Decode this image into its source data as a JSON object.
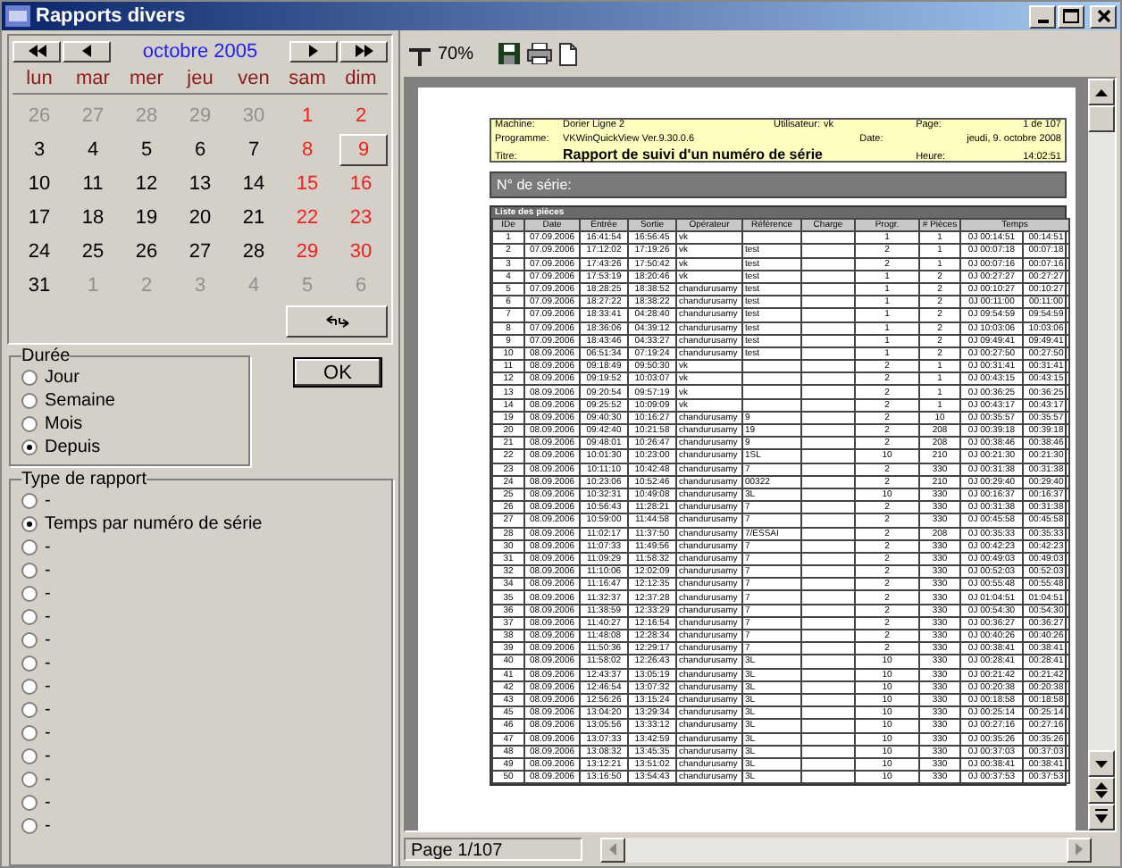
{
  "window": {
    "title": "Rapports divers"
  },
  "calendar": {
    "month": "octobre 2005",
    "weekdays": [
      "lun",
      "mar",
      "mer",
      "jeu",
      "ven",
      "sam",
      "dim"
    ],
    "weeks": [
      [
        {
          "day": "26",
          "other_month": true,
          "selected": false
        },
        {
          "day": "27",
          "other_month": true,
          "selected": false
        },
        {
          "day": "28",
          "other_month": true,
          "selected": false
        },
        {
          "day": "29",
          "other_month": true,
          "selected": false
        },
        {
          "day": "30",
          "other_month": true,
          "selected": false
        },
        {
          "day": "1",
          "other_month": false,
          "selected": false
        },
        {
          "day": "2",
          "other_month": false,
          "selected": false
        }
      ],
      [
        {
          "day": "3",
          "other_month": false,
          "selected": false
        },
        {
          "day": "4",
          "other_month": false,
          "selected": false
        },
        {
          "day": "5",
          "other_month": false,
          "selected": false
        },
        {
          "day": "6",
          "other_month": false,
          "selected": false
        },
        {
          "day": "7",
          "other_month": false,
          "selected": false
        },
        {
          "day": "8",
          "other_month": false,
          "selected": false
        },
        {
          "day": "9",
          "other_month": false,
          "selected": true
        }
      ],
      [
        {
          "day": "10",
          "other_month": false,
          "selected": false
        },
        {
          "day": "11",
          "other_month": false,
          "selected": false
        },
        {
          "day": "12",
          "other_month": false,
          "selected": false
        },
        {
          "day": "13",
          "other_month": false,
          "selected": false
        },
        {
          "day": "14",
          "other_month": false,
          "selected": false
        },
        {
          "day": "15",
          "other_month": false,
          "selected": false
        },
        {
          "day": "16",
          "other_month": false,
          "selected": false
        }
      ],
      [
        {
          "day": "17",
          "other_month": false,
          "selected": false
        },
        {
          "day": "18",
          "other_month": false,
          "selected": false
        },
        {
          "day": "19",
          "other_month": false,
          "selected": false
        },
        {
          "day": "20",
          "other_month": false,
          "selected": false
        },
        {
          "day": "21",
          "other_month": false,
          "selected": false
        },
        {
          "day": "22",
          "other_month": false,
          "selected": false
        },
        {
          "day": "23",
          "other_month": false,
          "selected": false
        }
      ],
      [
        {
          "day": "24",
          "other_month": false,
          "selected": false
        },
        {
          "day": "25",
          "other_month": false,
          "selected": false
        },
        {
          "day": "26",
          "other_month": false,
          "selected": false
        },
        {
          "day": "27",
          "other_month": false,
          "selected": false
        },
        {
          "day": "28",
          "other_month": false,
          "selected": false
        },
        {
          "day": "29",
          "other_month": false,
          "selected": false
        },
        {
          "day": "30",
          "other_month": false,
          "selected": false
        }
      ],
      [
        {
          "day": "31",
          "other_month": false,
          "selected": false
        },
        {
          "day": "1",
          "other_month": true,
          "selected": false
        },
        {
          "day": "2",
          "other_month": true,
          "selected": false
        },
        {
          "day": "3",
          "other_month": true,
          "selected": false
        },
        {
          "day": "4",
          "other_month": true,
          "selected": false
        },
        {
          "day": "5",
          "other_month": true,
          "selected": false
        },
        {
          "day": "6",
          "other_month": true,
          "selected": false
        }
      ]
    ]
  },
  "duree": {
    "title": "Durée",
    "options": [
      {
        "label": "Jour",
        "selected": false
      },
      {
        "label": "Semaine",
        "selected": false
      },
      {
        "label": "Mois",
        "selected": false
      },
      {
        "label": "Depuis",
        "selected": true
      }
    ]
  },
  "ok_button": "OK",
  "type_rapport": {
    "title": "Type de rapport",
    "options": [
      {
        "label": "-",
        "selected": false
      },
      {
        "label": "Temps par numéro de série",
        "selected": true
      },
      {
        "label": "-",
        "selected": false
      },
      {
        "label": "-",
        "selected": false
      },
      {
        "label": "-",
        "selected": false
      },
      {
        "label": "-",
        "selected": false
      },
      {
        "label": "-",
        "selected": false
      },
      {
        "label": "-",
        "selected": false
      },
      {
        "label": "-",
        "selected": false
      },
      {
        "label": "-",
        "selected": false
      },
      {
        "label": "-",
        "selected": false
      },
      {
        "label": "-",
        "selected": false
      },
      {
        "label": "-",
        "selected": false
      },
      {
        "label": "-",
        "selected": false
      },
      {
        "label": "-",
        "selected": false
      }
    ]
  },
  "toolbar": {
    "zoom": "70%"
  },
  "report": {
    "header": [
      {
        "label": "Machine:",
        "value": "Dorier Ligne 2",
        "label2": "Utilisateur:",
        "value2": "vk",
        "label3": "Page:",
        "value3": "1 de 107"
      },
      {
        "label": "Programme:",
        "value": "VKWinQuickView Ver.9.30.0.6",
        "label3": "Date:",
        "value3": "jeudi, 9. octobre 2008"
      },
      {
        "label": "Titre:",
        "value": "Rapport de suivi d'un numéro de série",
        "label3": "Heure:",
        "value3": "14:02:51"
      }
    ],
    "serial_label": "N° de série:",
    "table_title": "Liste des pièces",
    "columns": [
      "IDe",
      "Date",
      "Entrée",
      "Sortie",
      "Opérateur",
      "Référence",
      "Charge",
      "Progr.",
      "# Pièces",
      "Temps"
    ],
    "rows": [
      {
        "ide": "1",
        "date": "07.09.2006",
        "entree": "16:41:54",
        "sortie": "16:56:45",
        "operateur": "vk",
        "progr": "1",
        "pieces": "1",
        "temps": "0J 00:14:51",
        "temps_2": "00:14:51"
      },
      {
        "ide": "2",
        "date": "07.09.2006",
        "entree": "17:12:02",
        "sortie": "17:19:26",
        "operateur": "vk",
        "reference": "test",
        "progr": "2",
        "pieces": "1",
        "temps": "0J 00:07:18",
        "temps_2": "00:07:18"
      },
      {
        "ide": "3",
        "date": "07.09.2006",
        "entree": "17:43:26",
        "sortie": "17:50:42",
        "operateur": "vk",
        "reference": "test",
        "progr": "2",
        "pieces": "1",
        "temps": "0J 00:07:16",
        "temps_2": "00:07:16"
      },
      {
        "ide": "4",
        "date": "07.09.2006",
        "entree": "17:53:19",
        "sortie": "18:20:46",
        "operateur": "vk",
        "reference": "test",
        "progr": "1",
        "pieces": "2",
        "temps": "0J 00:27:27",
        "temps_2": "00:27:27"
      },
      {
        "ide": "5",
        "date": "07.09.2006",
        "entree": "18:28:25",
        "sortie": "18:38:52",
        "operateur": "chandurusamy",
        "reference": "test",
        "progr": "1",
        "pieces": "2",
        "temps": "0J 00:10:27",
        "temps_2": "00:10:27"
      },
      {
        "ide": "6",
        "date": "07.09.2006",
        "entree": "18:27:22",
        "sortie": "18:38:22",
        "operateur": "chandurusamy",
        "reference": "test",
        "progr": "1",
        "pieces": "2",
        "temps": "0J 00:11:00",
        "temps_2": "00:11:00"
      },
      {
        "ide": "7",
        "date": "07.09.2006",
        "entree": "18:33:41",
        "sortie": "04:28:40",
        "operateur": "chandurusamy",
        "reference": "test",
        "progr": "1",
        "pieces": "2",
        "temps": "0J 09:54:59",
        "temps_2": "09:54:59"
      },
      {
        "ide": "8",
        "date": "07.09.2006",
        "entree": "18:36:06",
        "sortie": "04:39:12",
        "operateur": "chandurusamy",
        "reference": "test",
        "progr": "1",
        "pieces": "2",
        "temps": "0J 10:03:06",
        "temps_2": "10:03:06"
      },
      {
        "ide": "9",
        "date": "07.09.2006",
        "entree": "18:43:46",
        "sortie": "04:33:27",
        "operateur": "chandurusamy",
        "reference": "test",
        "progr": "1",
        "pieces": "2",
        "temps": "0J 09:49:41",
        "temps_2": "09:49:41"
      },
      {
        "ide": "10",
        "date": "08.09.2006",
        "entree": "06:51:34",
        "sortie": "07:19:24",
        "operateur": "chandurusamy",
        "reference": "test",
        "progr": "1",
        "pieces": "2",
        "temps": "0J 00:27:50",
        "temps_2": "00:27:50"
      },
      {
        "ide": "11",
        "date": "08.09.2006",
        "entree": "09:18:49",
        "sortie": "09:50:30",
        "operateur": "vk",
        "progr": "2",
        "pieces": "1",
        "temps": "0J 00:31:41",
        "temps_2": "00:31:41"
      },
      {
        "ide": "12",
        "date": "08.09.2006",
        "entree": "09:19:52",
        "sortie": "10:03:07",
        "operateur": "vk",
        "progr": "2",
        "pieces": "1",
        "temps": "0J 00:43:15",
        "temps_2": "00:43:15"
      },
      {
        "ide": "13",
        "date": "08.09.2006",
        "entree": "09:20:54",
        "sortie": "09:57:19",
        "operateur": "vk",
        "progr": "2",
        "pieces": "1",
        "temps": "0J 00:36:25",
        "temps_2": "00:36:25"
      },
      {
        "ide": "14",
        "date": "08.09.2006",
        "entree": "09:25:52",
        "sortie": "10:09:09",
        "operateur": "vk",
        "progr": "2",
        "pieces": "1",
        "temps": "0J 00:43:17",
        "temps_2": "00:43:17"
      },
      {
        "ide": "19",
        "date": "08.09.2006",
        "entree": "09:40:30",
        "sortie": "10:16:27",
        "operateur": "chandurusamy",
        "reference": "9",
        "progr": "2",
        "pieces": "10",
        "temps": "0J 00:35:57",
        "temps_2": "00:35:57"
      },
      {
        "ide": "20",
        "date": "08.09.2006",
        "entree": "09:42:40",
        "sortie": "10:21:58",
        "operateur": "chandurusamy",
        "reference": "19",
        "progr": "2",
        "pieces": "208",
        "temps": "0J 00:39:18",
        "temps_2": "00:39:18"
      },
      {
        "ide": "21",
        "date": "08.09.2006",
        "entree": "09:48:01",
        "sortie": "10:26:47",
        "operateur": "chandurusamy",
        "reference": "9",
        "progr": "2",
        "pieces": "208",
        "temps": "0J 00:38:46",
        "temps_2": "00:38:46"
      },
      {
        "ide": "22",
        "date": "08.09.2006",
        "entree": "10:01:30",
        "sortie": "10:23:00",
        "operateur": "chandurusamy",
        "reference": "1SL",
        "progr": "10",
        "pieces": "210",
        "temps": "0J 00:21:30",
        "temps_2": "00:21:30"
      },
      {
        "ide": "23",
        "date": "08.09.2006",
        "entree": "10:11:10",
        "sortie": "10:42:48",
        "operateur": "chandurusamy",
        "reference": "7",
        "progr": "2",
        "pieces": "330",
        "temps": "0J 00:31:38",
        "temps_2": "00:31:38"
      },
      {
        "ide": "24",
        "date": "08.09.2006",
        "entree": "10:23:06",
        "sortie": "10:52:46",
        "operateur": "chandurusamy",
        "reference": "00322",
        "progr": "2",
        "pieces": "210",
        "temps": "0J 00:29:40",
        "temps_2": "00:29:40"
      },
      {
        "ide": "25",
        "date": "08.09.2006",
        "entree": "10:32:31",
        "sortie": "10:49:08",
        "operateur": "chandurusamy",
        "reference": "3L",
        "progr": "10",
        "pieces": "330",
        "temps": "0J 00:16:37",
        "temps_2": "00:16:37"
      },
      {
        "ide": "26",
        "date": "08.09.2006",
        "entree": "10:56:43",
        "sortie": "11:28:21",
        "operateur": "chandurusamy",
        "reference": "7",
        "progr": "2",
        "pieces": "330",
        "temps": "0J 00:31:38",
        "temps_2": "00:31:38"
      },
      {
        "ide": "27",
        "date": "08.09.2006",
        "entree": "10:59:00",
        "sortie": "11:44:58",
        "operateur": "chandurusamy",
        "reference": "7",
        "progr": "2",
        "pieces": "330",
        "temps": "0J 00:45:58",
        "temps_2": "00:45:58"
      },
      {
        "ide": "28",
        "date": "08.09.2006",
        "entree": "11:02:17",
        "sortie": "11:37:50",
        "operateur": "chandurusamy",
        "reference": "7/ESSAI",
        "progr": "2",
        "pieces": "208",
        "temps": "0J 00:35:33",
        "temps_2": "00:35:33"
      },
      {
        "ide": "30",
        "date": "08.09.2006",
        "entree": "11:07:33",
        "sortie": "11:49:56",
        "operateur": "chandurusamy",
        "reference": "7",
        "progr": "2",
        "pieces": "330",
        "temps": "0J 00:42:23",
        "temps_2": "00:42:23"
      },
      {
        "ide": "31",
        "date": "08.09.2006",
        "entree": "11:09:29",
        "sortie": "11:58:32",
        "operateur": "chandurusamy",
        "reference": "7",
        "progr": "2",
        "pieces": "330",
        "temps": "0J 00:49:03",
        "temps_2": "00:49:03"
      },
      {
        "ide": "32",
        "date": "08.09.2006",
        "entree": "11:10:06",
        "sortie": "12:02:09",
        "operateur": "chandurusamy",
        "reference": "7",
        "progr": "2",
        "pieces": "330",
        "temps": "0J 00:52:03",
        "temps_2": "00:52:03"
      },
      {
        "ide": "34",
        "date": "08.09.2006",
        "entree": "11:16:47",
        "sortie": "12:12:35",
        "operateur": "chandurusamy",
        "reference": "7",
        "progr": "2",
        "pieces": "330",
        "temps": "0J 00:55:48",
        "temps_2": "00:55:48"
      },
      {
        "ide": "35",
        "date": "08.09.2006",
        "entree": "11:32:37",
        "sortie": "12:37:28",
        "operateur": "chandurusamy",
        "reference": "7",
        "progr": "2",
        "pieces": "330",
        "temps": "0J 01:04:51",
        "temps_2": "01:04:51"
      },
      {
        "ide": "36",
        "date": "08.09.2006",
        "entree": "11:38:59",
        "sortie": "12:33:29",
        "operateur": "chandurusamy",
        "reference": "7",
        "progr": "2",
        "pieces": "330",
        "temps": "0J 00:54:30",
        "temps_2": "00:54:30"
      },
      {
        "ide": "37",
        "date": "08.09.2006",
        "entree": "11:40:27",
        "sortie": "12:16:54",
        "operateur": "chandurusamy",
        "reference": "7",
        "progr": "2",
        "pieces": "330",
        "temps": "0J 00:36:27",
        "temps_2": "00:36:27"
      },
      {
        "ide": "38",
        "date": "08.09.2006",
        "entree": "11:48:08",
        "sortie": "12:28:34",
        "operateur": "chandurusamy",
        "reference": "7",
        "progr": "2",
        "pieces": "330",
        "temps": "0J 00:40:26",
        "temps_2": "00:40:26"
      },
      {
        "ide": "39",
        "date": "08.09.2006",
        "entree": "11:50:36",
        "sortie": "12:29:17",
        "operateur": "chandurusamy",
        "reference": "7",
        "progr": "2",
        "pieces": "330",
        "temps": "0J 00:38:41",
        "temps_2": "00:38:41"
      },
      {
        "ide": "40",
        "date": "08.09.2006",
        "entree": "11:58:02",
        "sortie": "12:26:43",
        "operateur": "chandurusamy",
        "reference": "3L",
        "progr": "10",
        "pieces": "330",
        "temps": "0J 00:28:41",
        "temps_2": "00:28:41"
      },
      {
        "ide": "41",
        "date": "08.09.2006",
        "entree": "12:43:37",
        "sortie": "13:05:19",
        "operateur": "chandurusamy",
        "reference": "3L",
        "progr": "10",
        "pieces": "330",
        "temps": "0J 00:21:42",
        "temps_2": "00:21:42"
      },
      {
        "ide": "42",
        "date": "08.09.2006",
        "entree": "12:46:54",
        "sortie": "13:07:32",
        "operateur": "chandurusamy",
        "reference": "3L",
        "progr": "10",
        "pieces": "330",
        "temps": "0J 00:20:38",
        "temps_2": "00:20:38"
      },
      {
        "ide": "43",
        "date": "08.09.2006",
        "entree": "12:56:26",
        "sortie": "13:15:24",
        "operateur": "chandurusamy",
        "reference": "3L",
        "progr": "10",
        "pieces": "330",
        "temps": "0J 00:18:58",
        "temps_2": "00:18:58"
      },
      {
        "ide": "45",
        "date": "08.09.2006",
        "entree": "13:04:20",
        "sortie": "13:29:34",
        "operateur": "chandurusamy",
        "reference": "3L",
        "progr": "10",
        "pieces": "330",
        "temps": "0J 00:25:14",
        "temps_2": "00:25:14"
      },
      {
        "ide": "46",
        "date": "08.09.2006",
        "entree": "13:05:56",
        "sortie": "13:33:12",
        "operateur": "chandurusamy",
        "reference": "3L",
        "progr": "10",
        "pieces": "330",
        "temps": "0J 00:27:16",
        "temps_2": "00:27:16"
      },
      {
        "ide": "47",
        "date": "08.09.2006",
        "entree": "13:07:33",
        "sortie": "13:42:59",
        "operateur": "chandurusamy",
        "reference": "3L",
        "progr": "10",
        "pieces": "330",
        "temps": "0J 00:35:26",
        "temps_2": "00:35:26"
      },
      {
        "ide": "48",
        "date": "08.09.2006",
        "entree": "13:08:32",
        "sortie": "13:45:35",
        "operateur": "chandurusamy",
        "reference": "3L",
        "progr": "10",
        "pieces": "330",
        "temps": "0J 00:37:03",
        "temps_2": "00:37:03"
      },
      {
        "ide": "49",
        "date": "08.09.2006",
        "entree": "13:12:21",
        "sortie": "13:51:02",
        "operateur": "chandurusamy",
        "reference": "3L",
        "progr": "10",
        "pieces": "330",
        "temps": "0J 00:38:41",
        "temps_2": "00:38:41"
      },
      {
        "ide": "50",
        "date": "08.09.2006",
        "entree": "13:16:50",
        "sortie": "13:54:43",
        "operateur": "chandurusamy",
        "reference": "3L",
        "progr": "10",
        "pieces": "330",
        "temps": "0J 00:37:53",
        "temps_2": "00:37:53"
      }
    ]
  },
  "status": {
    "page": "Page 1/107"
  }
}
